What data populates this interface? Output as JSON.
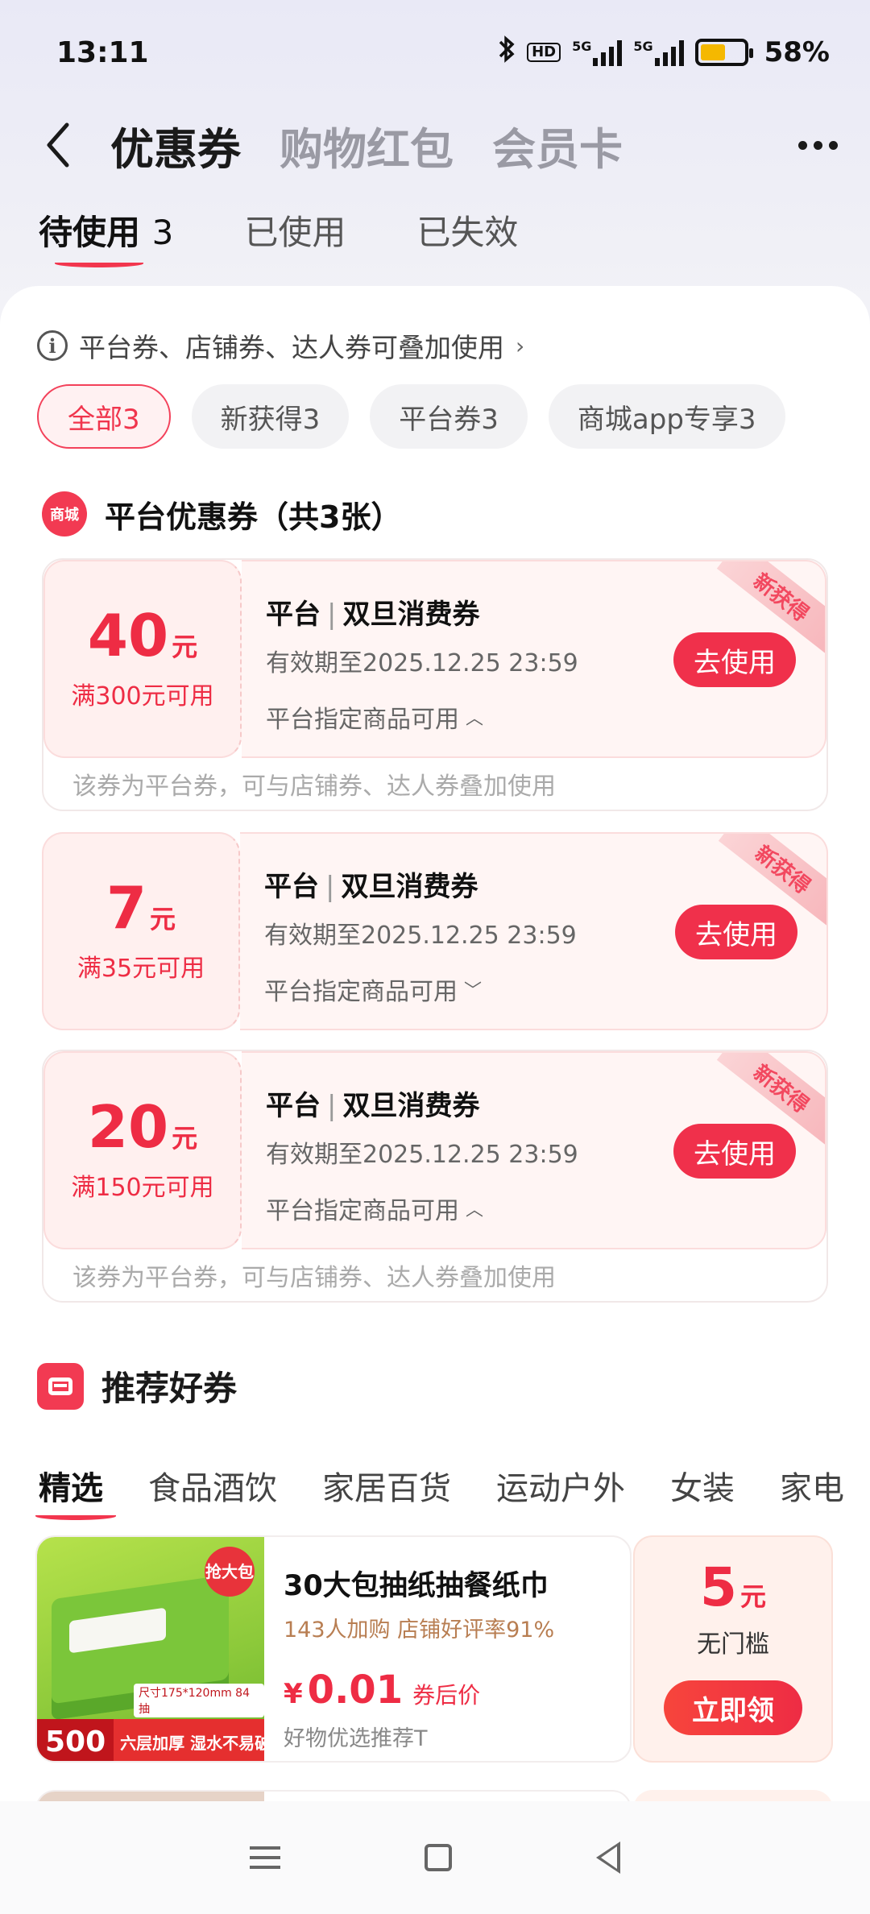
{
  "status_bar": {
    "time": "13:11",
    "battery": "58%",
    "hd_label": "HD",
    "net1": "5G",
    "net2": "5G"
  },
  "header": {
    "tabs": [
      "优惠券",
      "购物红包",
      "会员卡"
    ]
  },
  "sub_tabs": [
    {
      "label": "待使用",
      "count": "3"
    },
    {
      "label": "已使用"
    },
    {
      "label": "已失效"
    }
  ],
  "tip": "平台券、店铺券、达人券可叠加使用",
  "chips": [
    "全部3",
    "新获得3",
    "平台券3",
    "商城app专享3"
  ],
  "section": {
    "icon_text": "商城",
    "title": "平台优惠券（共3张）"
  },
  "coupons": [
    {
      "amount": "40",
      "unit": "元",
      "condition": "满300元可用",
      "source": "平台",
      "title": "双旦消费券",
      "valid": "有效期至2025.12.25 23:59",
      "scope": "平台指定商品可用",
      "button": "去使用",
      "ribbon": "新获得",
      "note": "该券为平台券，可与店铺券、达人券叠加使用"
    },
    {
      "amount": "7",
      "unit": "元",
      "condition": "满35元可用",
      "source": "平台",
      "title": "双旦消费券",
      "valid": "有效期至2025.12.25 23:59",
      "scope": "平台指定商品可用",
      "button": "去使用",
      "ribbon": "新获得"
    },
    {
      "amount": "20",
      "unit": "元",
      "condition": "满150元可用",
      "source": "平台",
      "title": "双旦消费券",
      "valid": "有效期至2025.12.25 23:59",
      "scope": "平台指定商品可用",
      "button": "去使用",
      "ribbon": "新获得",
      "note": "该券为平台券，可与店铺券、达人券叠加使用"
    }
  ],
  "recommend": {
    "title": "推荐好券",
    "categories": [
      "精选",
      "食品酒饮",
      "家居百货",
      "运动户外",
      "女装",
      "家电"
    ],
    "product": {
      "name": "30大包抽纸抽餐纸巾",
      "meta": "143人加购  店铺好评率91%",
      "price_symbol": "¥",
      "price": "0.01",
      "price_note": "券后价",
      "recommend": "好物优选推荐T",
      "img_badge": "抢大包",
      "img_count": "500",
      "img_feature": "六层加厚 湿水不易破",
      "img_spec": "尺寸175*120mm 84抽"
    },
    "reward": {
      "amount": "5",
      "unit": "元",
      "condition": "无门槛",
      "button": "立即领"
    }
  }
}
